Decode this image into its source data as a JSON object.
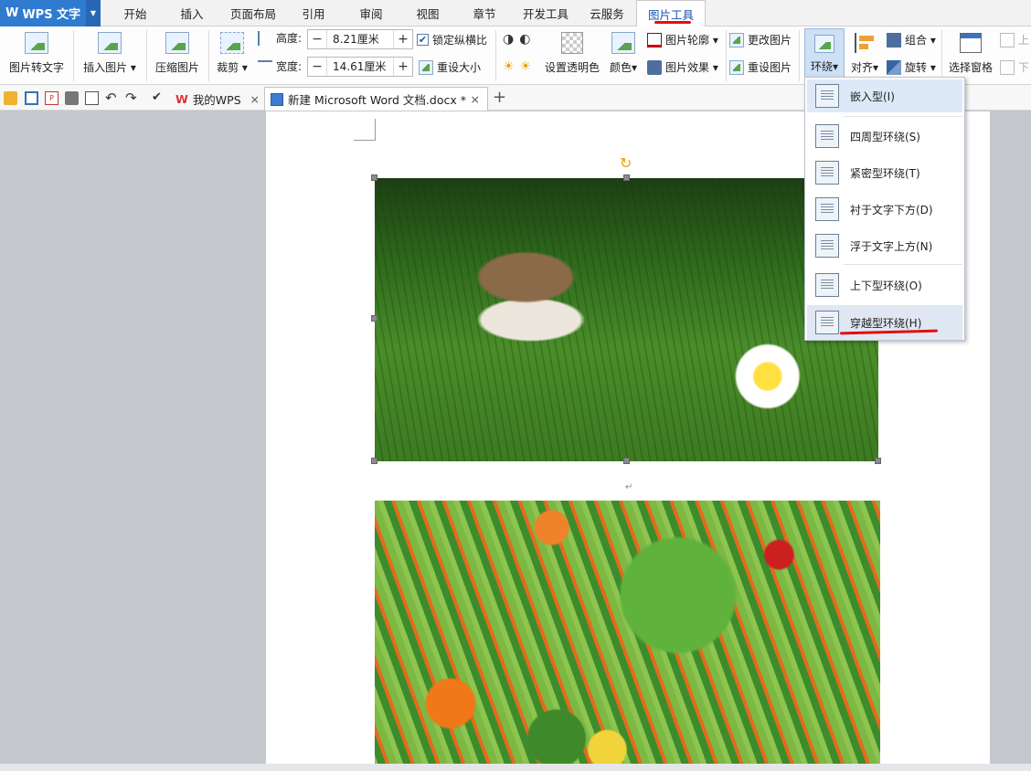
{
  "app": {
    "name": "WPS 文字",
    "logo": "W"
  },
  "menu_tabs": [
    "开始",
    "插入",
    "页面布局",
    "引用",
    "审阅",
    "视图",
    "章节",
    "开发工具",
    "云服务",
    "图片工具"
  ],
  "active_tab": "图片工具",
  "ribbon": {
    "pic_to_text": "图片转文字",
    "insert_pic": "插入图片",
    "compress_pic": "压缩图片",
    "crop": "裁剪",
    "height_label": "高度:",
    "height_value": "8.21厘米",
    "width_label": "宽度:",
    "width_value": "14.61厘米",
    "lock_ratio": "锁定纵横比",
    "resize": "重设大小",
    "set_transparent": "设置透明色",
    "color": "颜色",
    "pic_outline": "图片轮廓",
    "pic_effect": "图片效果",
    "change_pic": "更改图片",
    "reset_pic": "重设图片",
    "wrap": "环绕",
    "align": "对齐",
    "group": "组合",
    "rotate": "旋转",
    "select_pane": "选择窗格",
    "up": "上",
    "down": "下"
  },
  "quickbar": {
    "tab_mywps": "我的WPS",
    "tab_doc": "新建 Microsoft Word 文档.docx *",
    "add_tab": "+",
    "close": "×"
  },
  "document": {
    "paragraph_mark": "↵",
    "image1": "kitten-in-grass",
    "image2": "vegetables"
  },
  "wrap_menu": [
    "嵌入型(I)",
    "四周型环绕(S)",
    "紧密型环绕(T)",
    "衬于文字下方(D)",
    "浮于文字上方(N)",
    "上下型环绕(O)",
    "穿越型环绕(H)"
  ],
  "colors": {
    "accent": "#2f7bd0",
    "annotation": "#e01010"
  }
}
